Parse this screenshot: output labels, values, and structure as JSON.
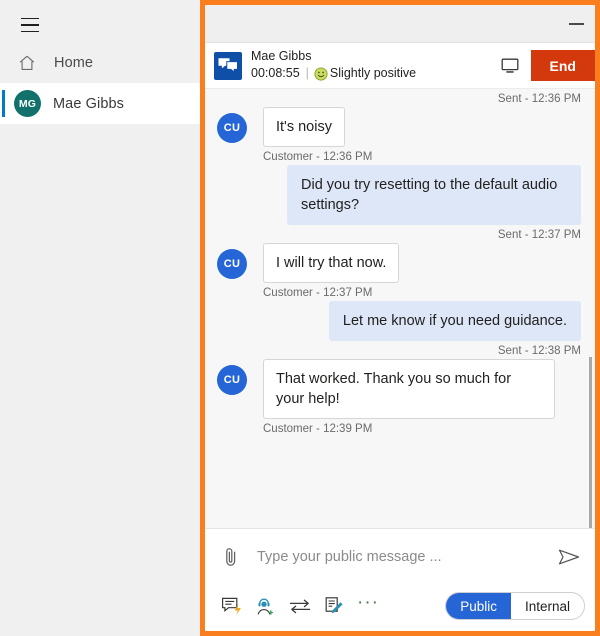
{
  "sidebar": {
    "menu_icon": "hamburger-menu-icon",
    "items": [
      {
        "label": "Home",
        "icon": "home-icon",
        "active": false
      },
      {
        "label": "Mae Gibbs",
        "icon": "avatar",
        "initials": "MG",
        "active": true
      }
    ]
  },
  "window": {
    "minimize_label": "Minimize",
    "minimize_icon": "minimize-icon"
  },
  "conversation": {
    "icon": "chat-bubble-icon",
    "customer_name": "Mae Gibbs",
    "timer": "00:08:55",
    "divider": "|",
    "sentiment_icon": "slightly-positive-emoji",
    "sentiment_label": "Slightly positive",
    "monitor_icon": "monitor-icon",
    "end_button_label": "End",
    "end_button_color": "#d4380d"
  },
  "transcript": {
    "entries": [
      {
        "type": "stamp-right",
        "text": "Sent - 12:36 PM"
      },
      {
        "type": "message-in",
        "avatar": "CU",
        "text": "It's noisy"
      },
      {
        "type": "stamp-left",
        "text": "Customer - 12:36 PM"
      },
      {
        "type": "message-out",
        "text": "Did you try resetting to the default audio settings?"
      },
      {
        "type": "stamp-right",
        "text": "Sent - 12:37 PM"
      },
      {
        "type": "message-in",
        "avatar": "CU",
        "text": "I will try that now."
      },
      {
        "type": "stamp-left",
        "text": "Customer - 12:37 PM"
      },
      {
        "type": "message-out",
        "text": "Let me know if you need guidance."
      },
      {
        "type": "stamp-right",
        "text": "Sent - 12:38 PM"
      },
      {
        "type": "message-in",
        "avatar": "CU",
        "text": "That worked. Thank you so much for your help!"
      },
      {
        "type": "stamp-left",
        "text": "Customer - 12:39 PM"
      }
    ]
  },
  "composer": {
    "attach_icon": "paperclip-icon",
    "placeholder": "Type your public message ...",
    "value": "",
    "send_icon": "send-icon",
    "tools": [
      {
        "name": "quick-replies-icon"
      },
      {
        "name": "add-agent-icon"
      },
      {
        "name": "transfer-icon"
      },
      {
        "name": "notes-icon"
      },
      {
        "name": "more-options-icon",
        "label": "···"
      }
    ],
    "mode": {
      "public_label": "Public",
      "internal_label": "Internal",
      "selected": "Public",
      "selected_color": "#2565d6"
    }
  },
  "colors": {
    "frame_orange": "#fa7d1e",
    "sidebar_bg": "#f0f0f0",
    "transcript_bg": "#f7f7f7",
    "agent_bubble": "#dee7f7",
    "customer_avatar": "#2565d6",
    "user_avatar": "#12726b",
    "nav_accent": "#0078d4"
  }
}
